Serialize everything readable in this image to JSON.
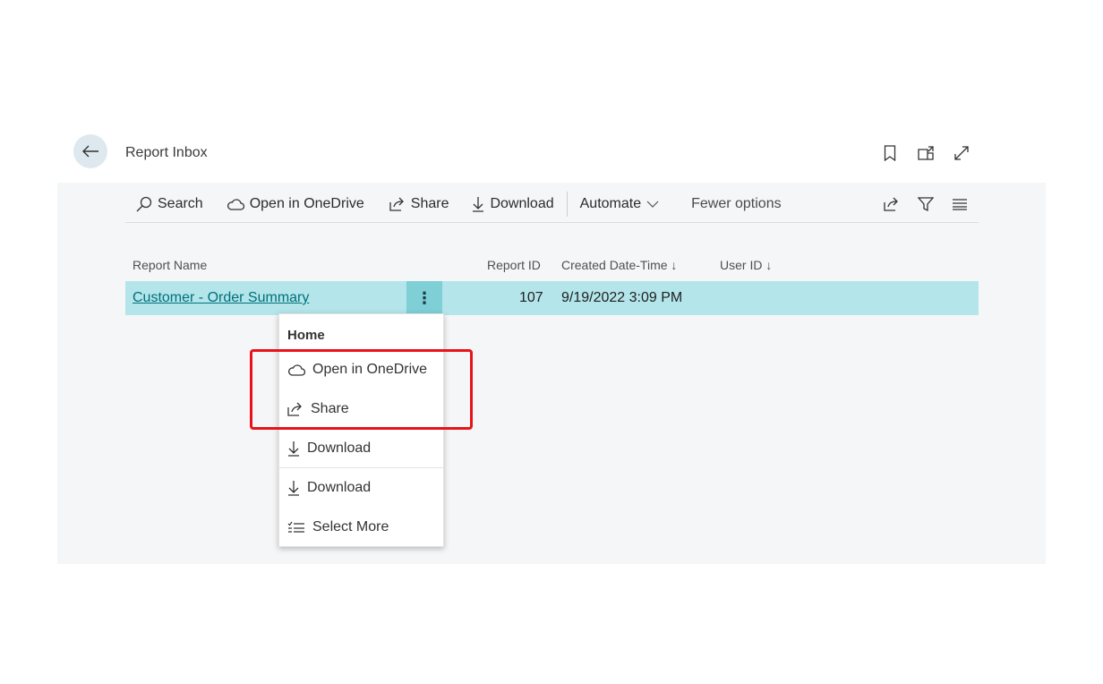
{
  "header": {
    "title": "Report Inbox",
    "icons": [
      "back-arrow-icon",
      "bookmark-icon",
      "open-new-window-icon",
      "expand-icon"
    ]
  },
  "toolbar": {
    "search": "Search",
    "open_onedrive": "Open in OneDrive",
    "share": "Share",
    "download": "Download",
    "automate": "Automate",
    "fewer_options": "Fewer options",
    "right_icons": [
      "share-icon",
      "filter-icon",
      "list-view-icon"
    ]
  },
  "table": {
    "columns": {
      "report_name": "Report Name",
      "report_id": "Report ID",
      "created": "Created Date-Time",
      "user_id": "User ID"
    },
    "rows": [
      {
        "report_name": "Customer - Order Summary",
        "report_id": "107",
        "created": "9/19/2022 3:09 PM",
        "user_id": ""
      }
    ]
  },
  "context_menu": {
    "heading": "Home",
    "items": [
      {
        "label": "Open in OneDrive",
        "icon": "cloud-icon"
      },
      {
        "label": "Share",
        "icon": "share-icon"
      },
      {
        "label": "Download",
        "icon": "download-icon"
      },
      {
        "label": "Download",
        "icon": "download-icon"
      },
      {
        "label": "Select More",
        "icon": "select-list-icon"
      }
    ]
  },
  "colors": {
    "row_selected": "#b3e5ea",
    "link": "#00707a",
    "highlight_border": "#e8131a",
    "panel_bg": "#f5f6f7"
  }
}
